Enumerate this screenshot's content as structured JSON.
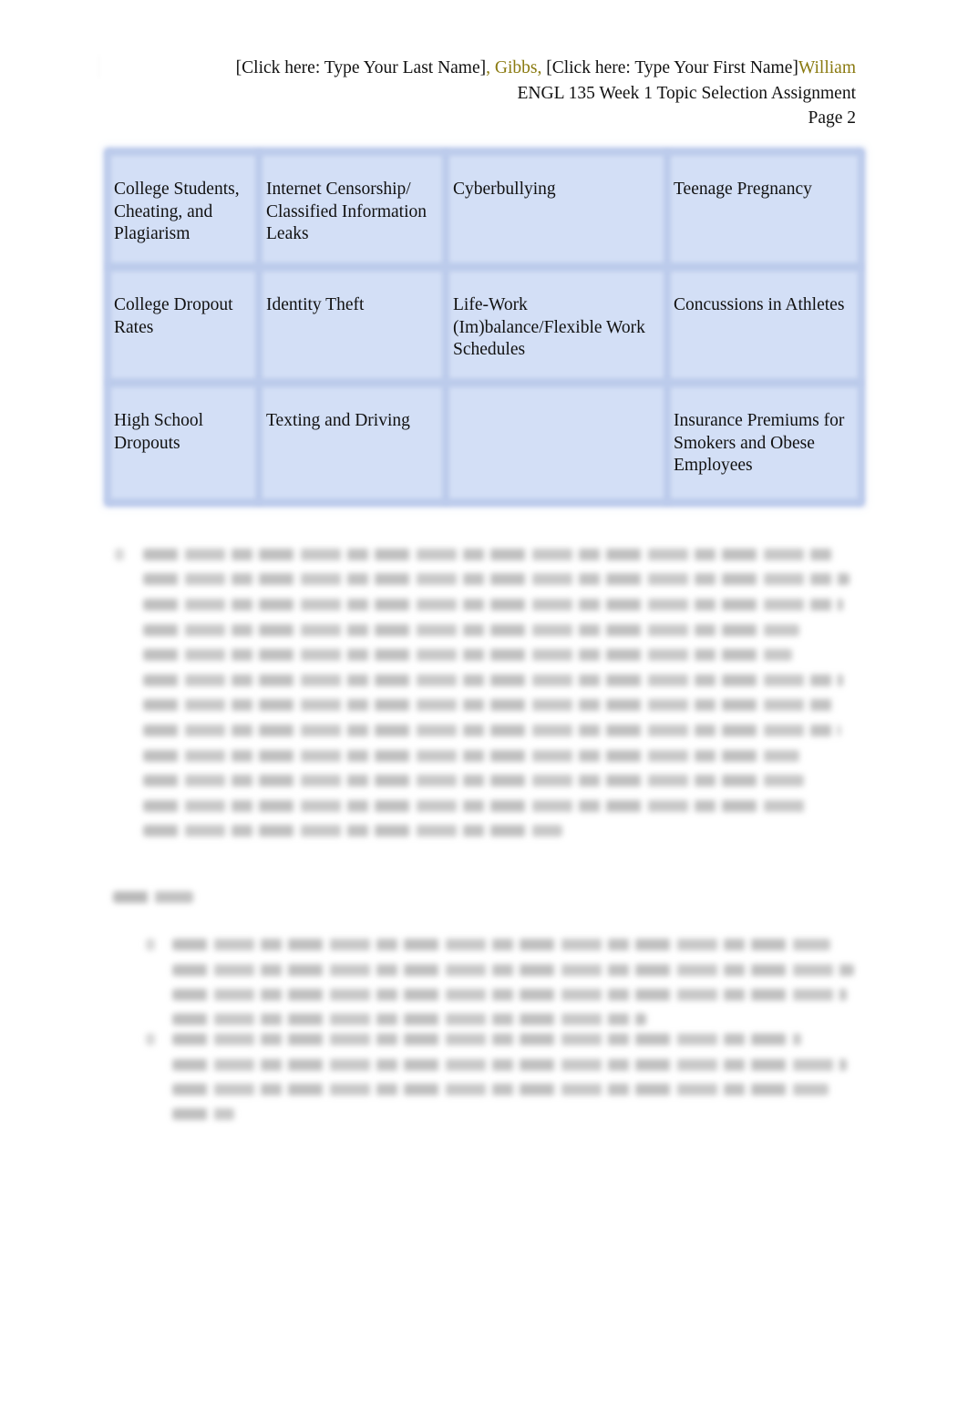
{
  "document": {
    "type": "Word document page",
    "header": {
      "last_name_prompt": "[Click here: Type Your Last Name]",
      "last_name_value": ", Gibbs,",
      "first_name_prompt": " [Click here: Type Your First Name]",
      "first_name_value": "William",
      "course_line": "ENGL 135 Week 1 Topic Selection Assignment",
      "page_label": "Page 2"
    },
    "accent_color": "#8a7a10",
    "table_fill_color": "#d3dff6",
    "topics_table": {
      "rows": [
        [
          "College Students, Cheating, and Plagiarism",
          "Internet Censorship/ Classified Information Leaks",
          "Cyberbullying",
          "Teenage Pregnancy"
        ],
        [
          "College Dropout Rates",
          "Identity Theft",
          "Life-Work (Im)balance/Flexible Work Schedules",
          "Concussions in Athletes"
        ],
        [
          "High School Dropouts",
          "Texting and Driving",
          "",
          "Insurance Premiums for Smokers and Obese Employees"
        ]
      ]
    },
    "blurred_sections": {
      "question_paragraph": "blurred (unreadable)",
      "examples_heading": "blurred (unreadable)",
      "examples_list": "blurred (unreadable)"
    }
  }
}
